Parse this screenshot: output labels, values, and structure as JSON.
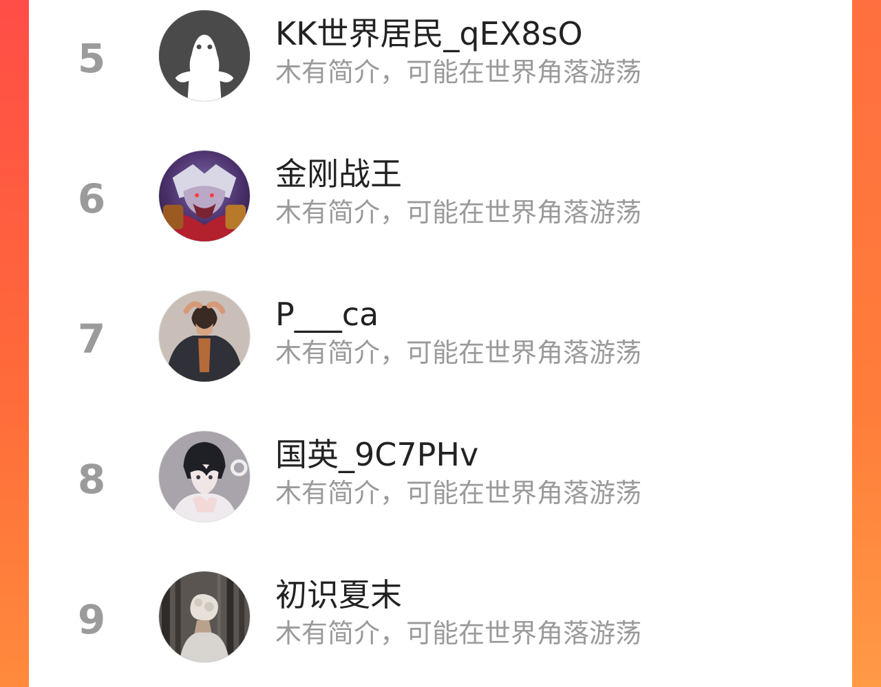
{
  "ranking_list": {
    "items": [
      {
        "rank": "5",
        "name": "KK世界居民_qEX8sO",
        "bio": "木有简介，可能在世界角落游荡",
        "avatar": "default-ghost-avatar"
      },
      {
        "rank": "6",
        "name": "金刚战王",
        "bio": "木有简介，可能在世界角落游荡",
        "avatar": "werewolf-warrior-avatar"
      },
      {
        "rank": "7",
        "name": "P___ca",
        "bio": "木有简介，可能在世界角落游荡",
        "avatar": "man-dark-coat-avatar"
      },
      {
        "rank": "8",
        "name": "国英_9C7PHv",
        "bio": "木有简介，可能在世界角落游荡",
        "avatar": "anime-boy-avatar"
      },
      {
        "rank": "9",
        "name": "初识夏末",
        "bio": "木有简介，可能在世界角落游荡",
        "avatar": "forest-person-avatar"
      }
    ]
  },
  "colors": {
    "background_gradient_top": "#ff4d47",
    "background_gradient_bottom": "#ff8a3c",
    "card": "#ffffff",
    "rank_text": "#9b9b9b",
    "name_text": "#222222",
    "bio_text": "#9a9a9a"
  }
}
